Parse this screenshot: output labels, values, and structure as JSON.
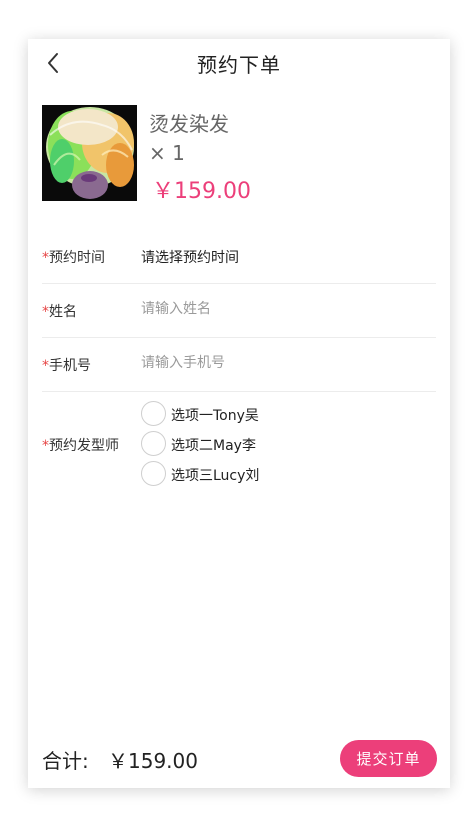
{
  "header": {
    "title": "预约下单",
    "back_icon": "chevron-left-icon"
  },
  "product": {
    "name": "烫发染发",
    "quantity": "× 1",
    "price": "￥159.00",
    "price_color": "#ec3f7a"
  },
  "form": {
    "required_mark": "*",
    "time": {
      "label": "预约时间",
      "value": "请选择预约时间"
    },
    "name": {
      "label": "姓名",
      "placeholder": "请输入姓名",
      "value": ""
    },
    "phone": {
      "label": "手机号",
      "placeholder": "请输入手机号",
      "value": ""
    },
    "stylist": {
      "label": "预约发型师",
      "options": [
        {
          "label": "选项一Tony吴",
          "selected": false
        },
        {
          "label": "选项二May李",
          "selected": false
        },
        {
          "label": "选项三Lucy刘",
          "selected": false
        }
      ]
    }
  },
  "footer": {
    "total_label": "合计:",
    "total_value": "￥159.00",
    "submit_label": "提交订单",
    "accent_color": "#ec3f7a"
  }
}
